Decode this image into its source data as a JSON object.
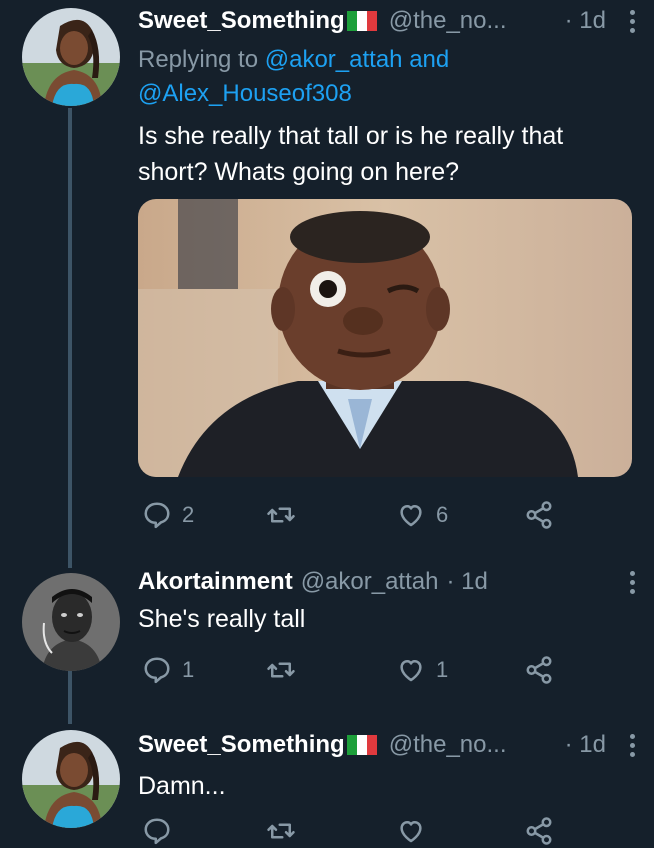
{
  "tweets": [
    {
      "name": "Sweet_Something",
      "handle": "@the_no...",
      "time": "· 1d",
      "replying_prefix": "Replying to ",
      "mention1": "@akor_attah",
      "and": " and",
      "mention2": "@Alex_Houseof308",
      "text": "Is she really that tall or is he really that short? Whats going on here?",
      "replies": "2",
      "retweets": "",
      "likes": "6"
    },
    {
      "name": "Akortainment",
      "handle": "@akor_attah",
      "time": "· 1d",
      "text": "She's really tall",
      "replies": "1",
      "retweets": "",
      "likes": "1"
    },
    {
      "name": "Sweet_Something",
      "handle": "@the_no...",
      "time": "· 1d",
      "text": "Damn...",
      "replies": "",
      "retweets": "",
      "likes": ""
    }
  ],
  "icons": [
    "reply-icon",
    "retweet-icon",
    "like-icon",
    "share-icon",
    "more-icon"
  ],
  "colors": {
    "background": "#15202b",
    "secondary_text": "#8899a6",
    "link": "#1da1f2",
    "thread_line": "#3d5466"
  }
}
